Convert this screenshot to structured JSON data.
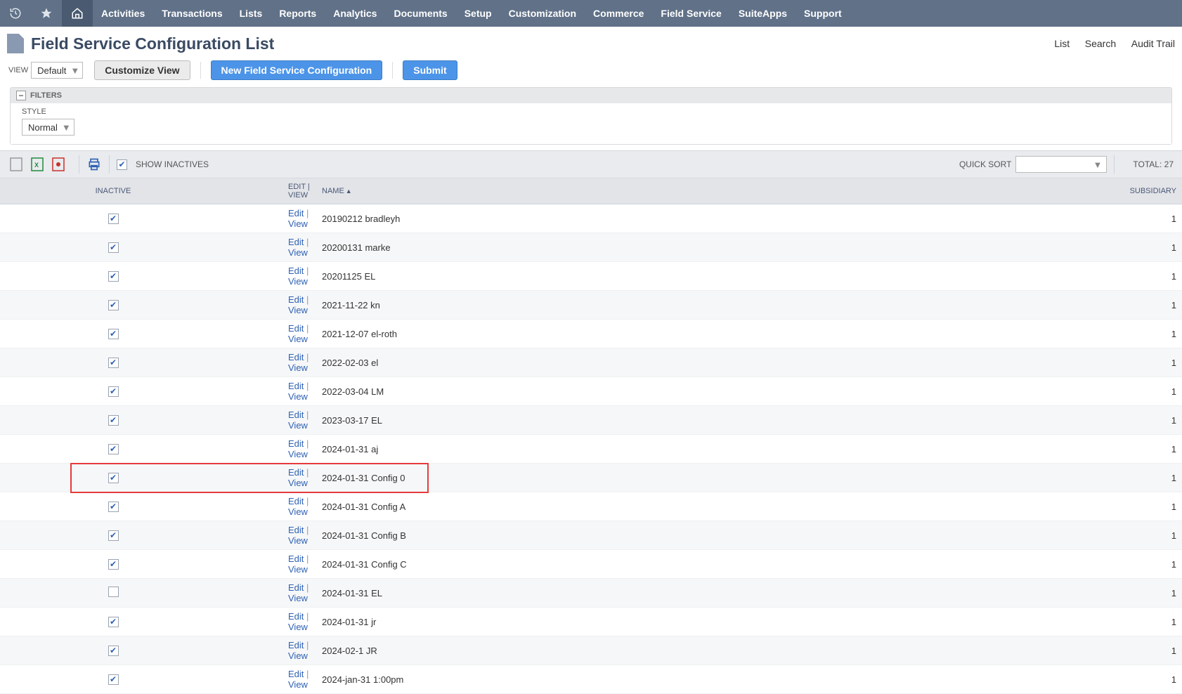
{
  "nav": {
    "items": [
      "Activities",
      "Transactions",
      "Lists",
      "Reports",
      "Analytics",
      "Documents",
      "Setup",
      "Customization",
      "Commerce",
      "Field Service",
      "SuiteApps",
      "Support"
    ]
  },
  "page": {
    "title": "Field Service Configuration List",
    "links": {
      "list": "List",
      "search": "Search",
      "audit": "Audit Trail"
    }
  },
  "actions": {
    "view_label": "VIEW",
    "view_value": "Default",
    "customize": "Customize View",
    "new_config": "New Field Service Configuration",
    "submit": "Submit"
  },
  "filters": {
    "header": "FILTERS",
    "style_label": "STYLE",
    "style_value": "Normal"
  },
  "toolbar": {
    "show_inactives": "SHOW INACTIVES",
    "show_inactives_checked": true,
    "quicksort_label": "QUICK SORT",
    "total_label": "TOTAL: 27"
  },
  "table": {
    "headers": {
      "inactive": "INACTIVE",
      "editview": "EDIT | VIEW",
      "name": "NAME",
      "subsidiary": "SUBSIDIARY"
    },
    "edit_label": "Edit",
    "view_label": "View",
    "rows": [
      {
        "inactive": true,
        "name": "20190212 bradleyh",
        "subsidiary": "1",
        "hl": false
      },
      {
        "inactive": true,
        "name": "20200131 marke",
        "subsidiary": "1",
        "hl": false
      },
      {
        "inactive": true,
        "name": "20201125 EL",
        "subsidiary": "1",
        "hl": false
      },
      {
        "inactive": true,
        "name": "2021-11-22 kn",
        "subsidiary": "1",
        "hl": false
      },
      {
        "inactive": true,
        "name": "2021-12-07 el-roth",
        "subsidiary": "1",
        "hl": false
      },
      {
        "inactive": true,
        "name": "2022-02-03 el",
        "subsidiary": "1",
        "hl": false
      },
      {
        "inactive": true,
        "name": "2022-03-04 LM",
        "subsidiary": "1",
        "hl": false
      },
      {
        "inactive": true,
        "name": "2023-03-17 EL",
        "subsidiary": "1",
        "hl": false
      },
      {
        "inactive": true,
        "name": "2024-01-31 aj",
        "subsidiary": "1",
        "hl": false
      },
      {
        "inactive": true,
        "name": "2024-01-31 Config 0",
        "subsidiary": "1",
        "hl": true
      },
      {
        "inactive": true,
        "name": "2024-01-31 Config A",
        "subsidiary": "1",
        "hl": false
      },
      {
        "inactive": true,
        "name": "2024-01-31 Config B",
        "subsidiary": "1",
        "hl": false
      },
      {
        "inactive": true,
        "name": "2024-01-31 Config C",
        "subsidiary": "1",
        "hl": false
      },
      {
        "inactive": false,
        "name": "2024-01-31 EL",
        "subsidiary": "1",
        "hl": false
      },
      {
        "inactive": true,
        "name": "2024-01-31 jr",
        "subsidiary": "1",
        "hl": false
      },
      {
        "inactive": true,
        "name": "2024-02-1 JR",
        "subsidiary": "1",
        "hl": false
      },
      {
        "inactive": true,
        "name": "2024-jan-31 1:00pm",
        "subsidiary": "1",
        "hl": false
      }
    ]
  }
}
